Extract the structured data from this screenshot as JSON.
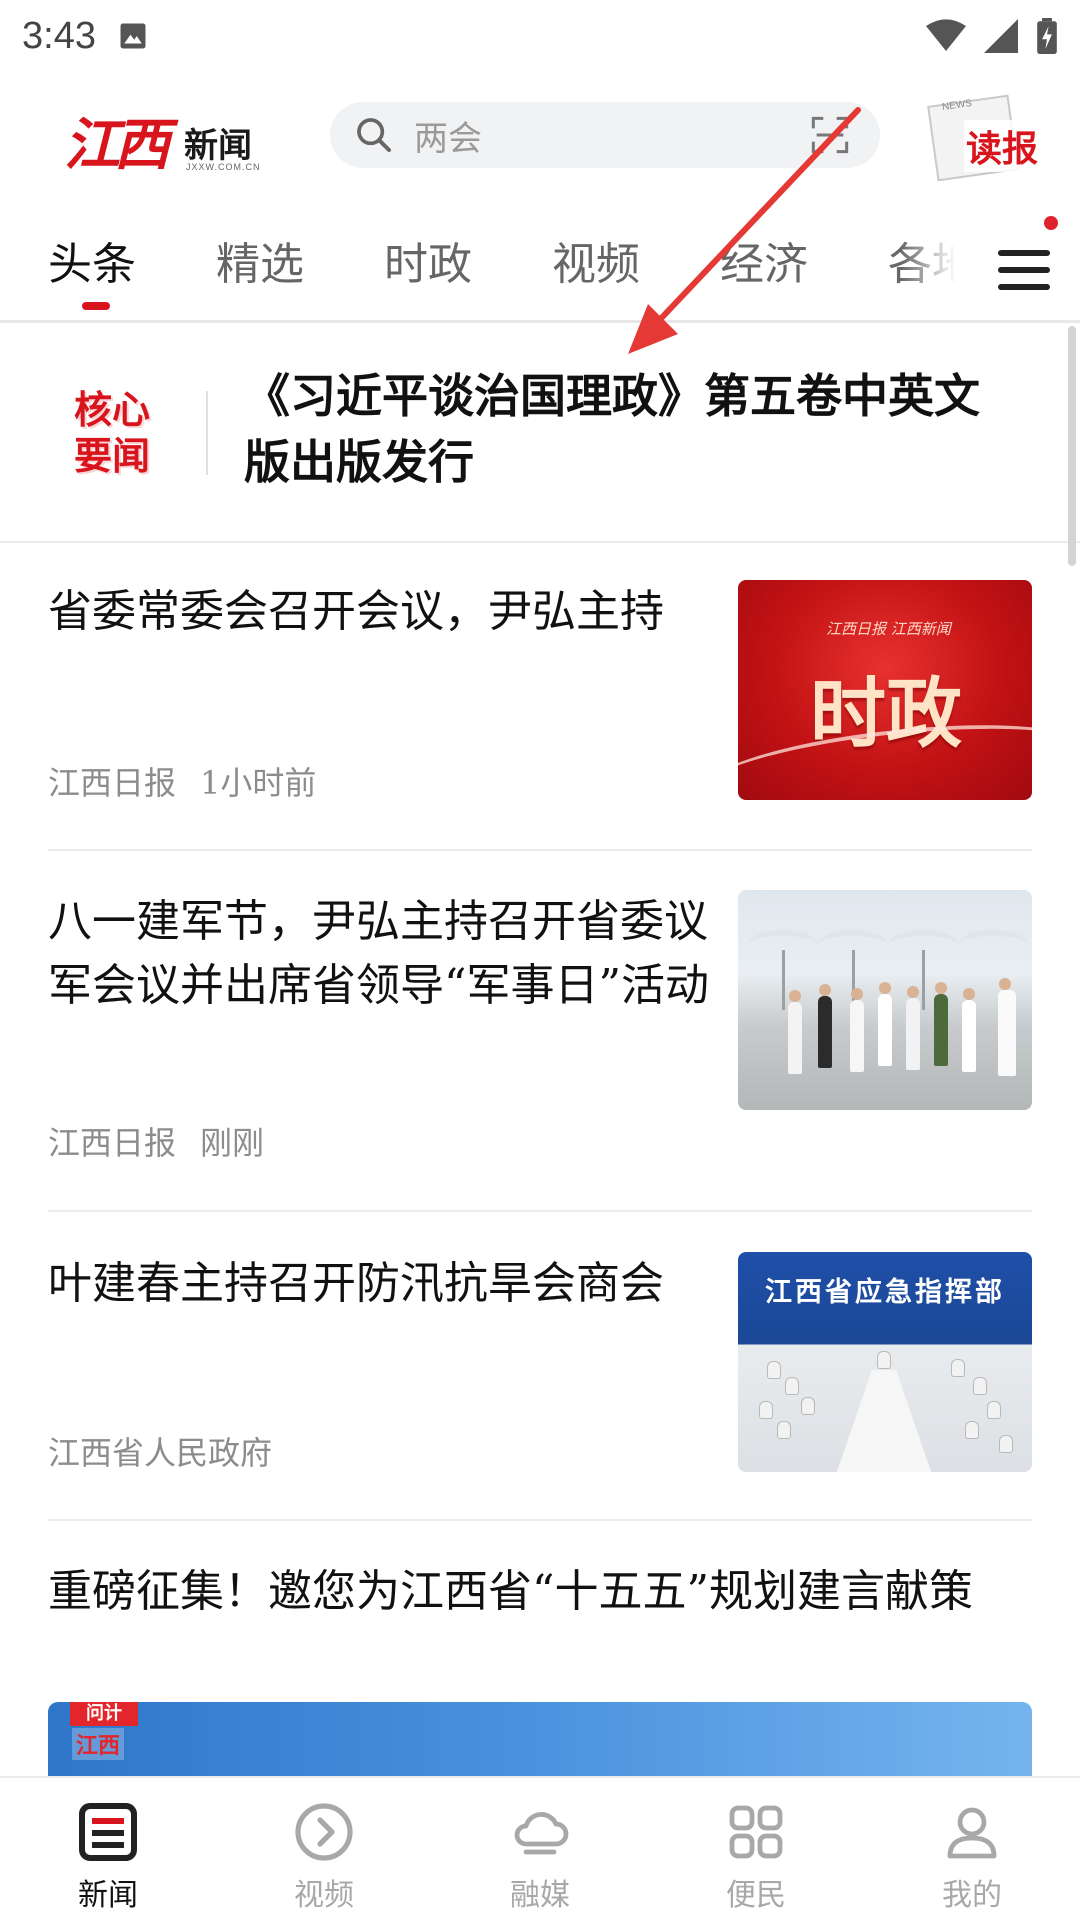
{
  "status_bar": {
    "time": "3:43"
  },
  "header": {
    "logo_main": "江西",
    "logo_sub": "新闻",
    "logo_url": "JXXW.COM.CN",
    "search_placeholder": "两会",
    "read_paper_label": "读报",
    "read_paper_news": "NEWS"
  },
  "tabs": [
    {
      "label": "头条",
      "active": true
    },
    {
      "label": "精选",
      "active": false
    },
    {
      "label": "时政",
      "active": false
    },
    {
      "label": "视频",
      "active": false
    },
    {
      "label": "经济",
      "active": false
    },
    {
      "label": "各地",
      "active": false
    }
  ],
  "headline": {
    "badge_line1": "核心",
    "badge_line2": "要闻",
    "title": "《习近平谈治国理政》第五卷中英文版出版发行"
  },
  "news": [
    {
      "title": "省委常委会召开会议，尹弘主持",
      "source": "江西日报",
      "time": "1小时前",
      "thumb_brand": "江西日报  江西新闻",
      "thumb_text": "时政"
    },
    {
      "title": "八一建军节，尹弘主持召开省委议军会议并出席省领导“军事日”活动",
      "source": "江西日报",
      "time": "刚刚"
    },
    {
      "title": "叶建春主持召开防汛抗旱会商会",
      "source": "江西省人民政府",
      "time": "",
      "thumb_banner": "江西省应急指挥部"
    },
    {
      "title": "重磅征集！邀您为江西省“十五五”规划建言献策"
    }
  ],
  "promo": {
    "tag1": "问计",
    "tag2": "江西"
  },
  "bottom_nav": [
    {
      "label": "新闻",
      "icon": "news-icon",
      "active": true
    },
    {
      "label": "视频",
      "icon": "video-icon",
      "active": false
    },
    {
      "label": "融媒",
      "icon": "cloud-icon",
      "active": false
    },
    {
      "label": "便民",
      "icon": "grid-icon",
      "active": false
    },
    {
      "label": "我的",
      "icon": "profile-icon",
      "active": false
    }
  ],
  "colors": {
    "brand_red": "#d8141c",
    "text_primary": "#111111",
    "text_secondary": "#8c8c8c",
    "tab_inactive": "#666666",
    "search_bg": "#f1f2f4",
    "annotation_arrow": "#e53935"
  }
}
